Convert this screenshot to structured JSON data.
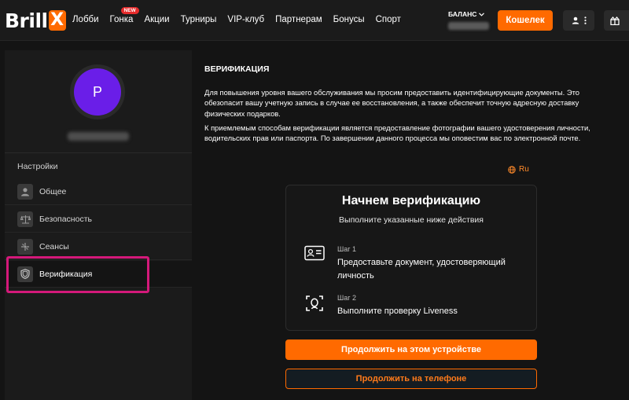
{
  "header": {
    "logo_text": "Brill",
    "logo_mark": "X",
    "nav": [
      {
        "label": "Лобби"
      },
      {
        "label": "Гонка",
        "badge": "NEW"
      },
      {
        "label": "Акции"
      },
      {
        "label": "Турниры"
      },
      {
        "label": "VIP-клуб"
      },
      {
        "label": "Партнерам"
      },
      {
        "label": "Бонусы"
      },
      {
        "label": "Спорт"
      }
    ],
    "balance_label": "БАЛАНС",
    "wallet_label": "Кошелек"
  },
  "sidebar": {
    "avatar_initial": "P",
    "settings_title": "Настройки",
    "items": [
      {
        "label": "Общее",
        "icon": "user-icon"
      },
      {
        "label": "Безопасность",
        "icon": "scales-icon"
      },
      {
        "label": "Сеансы",
        "icon": "sessions-icon"
      },
      {
        "label": "Верификация",
        "icon": "shield-icon"
      }
    ]
  },
  "main": {
    "title": "ВЕРИФИКАЦИЯ",
    "paragraph1": "Для повышения уровня вашего обслуживания мы просим предоставить идентифицирующие документы. Это обезопасит вашу учетную запись в случае ее восстановления, а также обеспечит точную адресную доставку физических подарков.",
    "paragraph2": "К приемлемым способам верификации является предоставление фотографии вашего удостоверения личности, водительских прав или паспорта. По завершении данного процесса мы оповестим вас по электронной почте.",
    "language": "Ru",
    "card": {
      "title": "Начнем верификацию",
      "subtitle": "Выполните указанные ниже действия",
      "steps": [
        {
          "label": "Шаг 1",
          "text": "Предоставьте документ, удостоверяющий личность",
          "icon": "id-card-icon"
        },
        {
          "label": "Шаг 2",
          "text": "Выполните проверку Liveness",
          "icon": "face-scan-icon"
        }
      ]
    },
    "continue_here_label": "Продолжить на этом устройстве",
    "continue_phone_label": "Продолжить на телефоне"
  },
  "colors": {
    "accent": "#ff6a00",
    "avatar": "#6a1ee8",
    "highlight": "#d4197a",
    "badge": "#e52b2b"
  }
}
